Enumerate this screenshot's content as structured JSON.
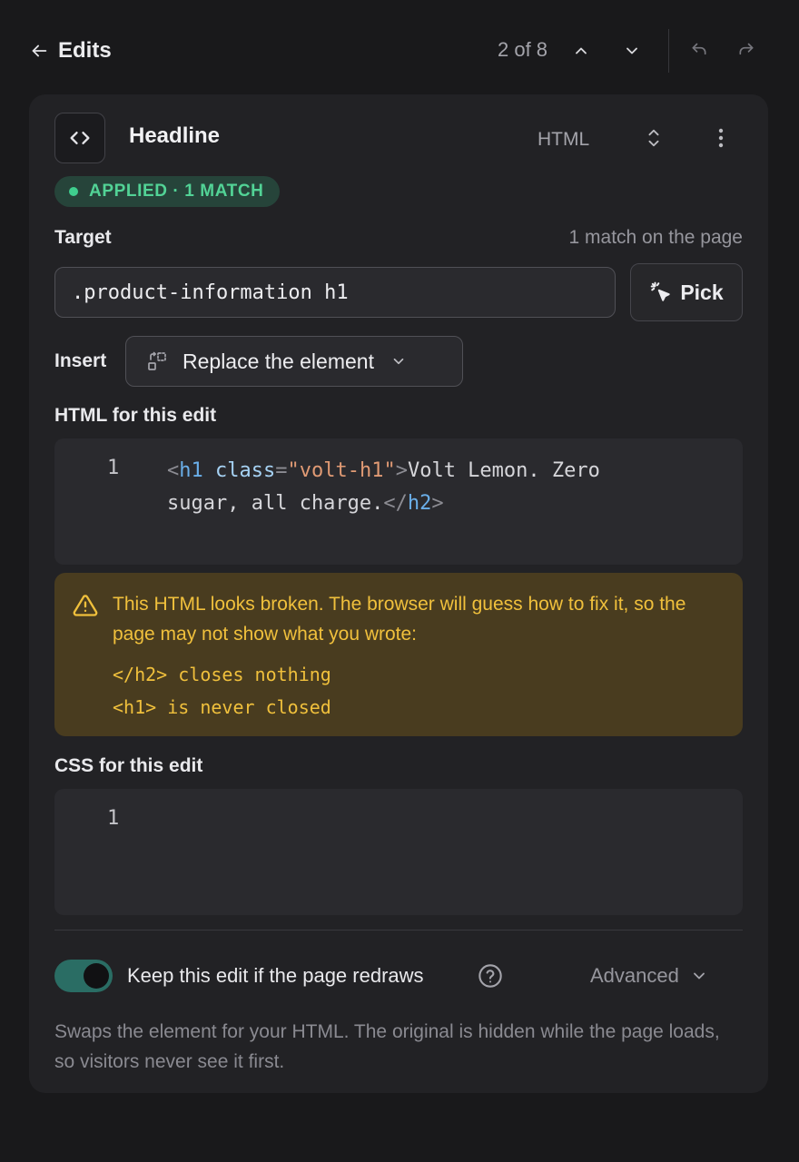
{
  "topbar": {
    "back_label": "Edits",
    "counter": "2 of 8"
  },
  "edit": {
    "title": "Headline",
    "language": "HTML",
    "status_badge": "APPLIED · 1 MATCH",
    "target_label": "Target",
    "target_match_text": "1 match on the page",
    "target_selector": ".product-information h1",
    "pick_label": "Pick",
    "insert_label": "Insert",
    "insert_value": "Replace the element",
    "html_label": "HTML for this edit",
    "html_code": {
      "line_number": "1",
      "tokens": [
        "<",
        "h1",
        " ",
        "class",
        "=",
        "\"volt-h1\"",
        ">",
        "Volt Lemon. Zero sugar, all charge.",
        "</",
        "h2",
        ">"
      ]
    },
    "warning": {
      "message": "This HTML looks broken. The browser will guess how to fix it, so the page may not show what you wrote:",
      "items": [
        "</h2> closes nothing",
        "<h1> is never closed"
      ]
    },
    "css_label": "CSS for this edit",
    "css_code": {
      "line_number": "1",
      "text": ""
    },
    "keep_toggle": {
      "label": "Keep this edit if the page redraws",
      "on": true
    },
    "advanced_label": "Advanced",
    "footnote": "Swaps the element for your HTML. The original is hidden while the page loads, so visitors never see it first."
  },
  "colors": {
    "background": "#19191b",
    "card": "#222225",
    "success": "#52d396",
    "warning_bg": "#493c1f",
    "warning_text": "#f0c03c",
    "toggle_on": "#2a6d64"
  },
  "icons": {
    "back": "arrow-left-icon",
    "prev": "chevron-up-icon",
    "next": "chevron-down-icon",
    "undo": "undo-icon",
    "redo": "redo-icon",
    "type": "code-brackets-icon",
    "sort": "chevron-up-down-icon",
    "menu": "more-vertical-icon",
    "pick": "cursor-click-icon",
    "insert": "replace-element-icon",
    "warning": "warning-triangle-icon",
    "help": "question-circle-icon"
  }
}
